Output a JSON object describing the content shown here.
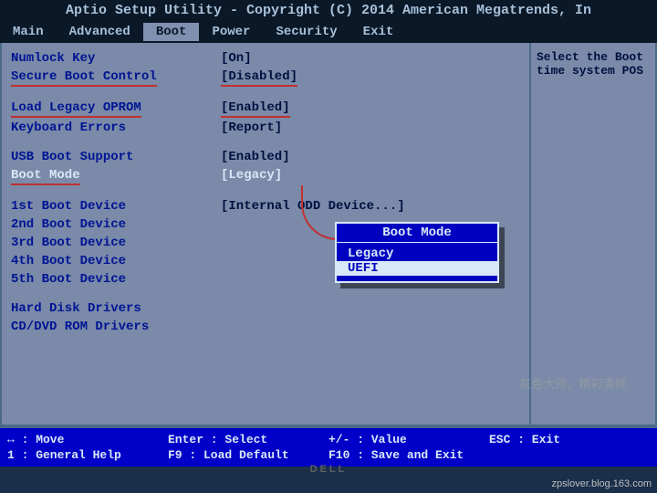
{
  "header": {
    "title": "Aptio Setup Utility - Copyright (C) 2014 American Megatrends, In"
  },
  "menu": {
    "items": [
      "Main",
      "Advanced",
      "Boot",
      "Power",
      "Security",
      "Exit"
    ],
    "active_index": 2
  },
  "settings": {
    "numlock": {
      "label": "Numlock Key",
      "value": "[On]"
    },
    "secure_boot": {
      "label": "Secure Boot Control",
      "value": "[Disabled]"
    },
    "load_legacy_oprom": {
      "label": "Load Legacy OPROM",
      "value": "[Enabled]"
    },
    "keyboard_errors": {
      "label": "Keyboard Errors",
      "value": "[Report]"
    },
    "usb_boot": {
      "label": "USB Boot Support",
      "value": "[Enabled]"
    },
    "boot_mode": {
      "label": "Boot Mode",
      "value": "[Legacy]"
    },
    "boot1": {
      "label": "1st Boot Device",
      "value": "[Internal ODD Device...]"
    },
    "boot2": {
      "label": "2nd Boot Device",
      "value": ""
    },
    "boot3": {
      "label": "3rd Boot Device",
      "value": ""
    },
    "boot4": {
      "label": "4th Boot Device",
      "value": ""
    },
    "boot5": {
      "label": "5th Boot Device",
      "value": ""
    },
    "hdd": {
      "label": "Hard Disk Drivers"
    },
    "cddvd": {
      "label": "CD/DVD ROM Drivers"
    }
  },
  "help": {
    "text": "Select the Boot time system POS"
  },
  "popup": {
    "title": "Boot Mode",
    "options": [
      "Legacy",
      "UEFI"
    ],
    "selected_index": 1
  },
  "footer": {
    "row1": {
      "c1": "↔ : Move",
      "c2": "Enter : Select",
      "c3": "+/- : Value",
      "c4": "ESC : Exit"
    },
    "row2": {
      "c1": "1 : General Help",
      "c2": "F9 : Load Default",
      "c3": "F10 : Save and Exit",
      "c4": ""
    }
  },
  "watermark": "灰色大师，精彩演绎.",
  "blog": "zpslover.blog.163.com",
  "brand": "DELL"
}
